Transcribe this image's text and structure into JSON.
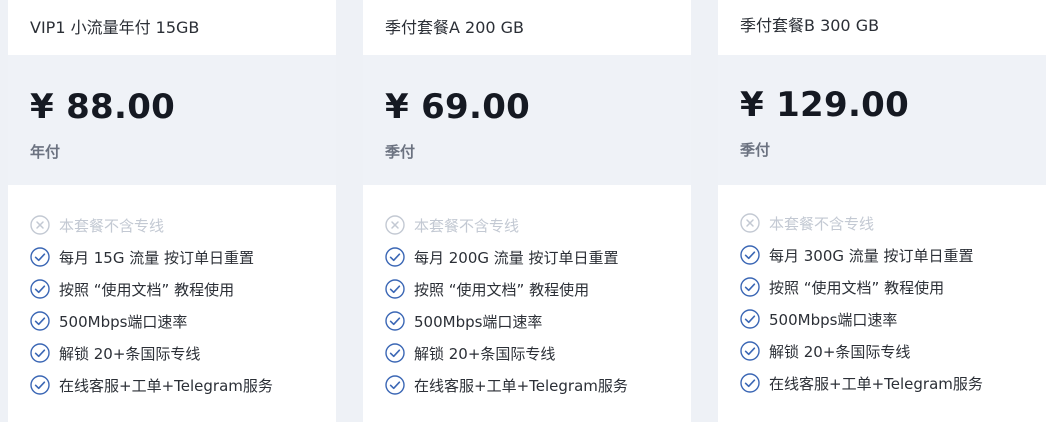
{
  "plans": [
    {
      "name": "VIP1 小流量年付 15GB",
      "price": "¥ 88.00",
      "period": "年付",
      "features": [
        {
          "text": "本套餐不含专线",
          "icon": "x-circle-icon",
          "enabled": false
        },
        {
          "text": "每月 15G 流量 按订单日重置",
          "icon": "check-circle-icon",
          "enabled": true
        },
        {
          "text": "按照 “使用文档” 教程使用",
          "icon": "check-circle-icon",
          "enabled": true
        },
        {
          "text": "500Mbps端口速率",
          "icon": "check-circle-icon",
          "enabled": true
        },
        {
          "text": "解锁 20+条国际专线",
          "icon": "check-circle-icon",
          "enabled": true
        },
        {
          "text": "在线客服+工单+Telegram服务",
          "icon": "check-circle-icon",
          "enabled": true
        }
      ]
    },
    {
      "name": "季付套餐A 200 GB",
      "price": "¥ 69.00",
      "period": "季付",
      "features": [
        {
          "text": "本套餐不含专线",
          "icon": "x-circle-icon",
          "enabled": false
        },
        {
          "text": "每月 200G 流量 按订单日重置",
          "icon": "check-circle-icon",
          "enabled": true
        },
        {
          "text": "按照 “使用文档” 教程使用",
          "icon": "check-circle-icon",
          "enabled": true
        },
        {
          "text": "500Mbps端口速率",
          "icon": "check-circle-icon",
          "enabled": true
        },
        {
          "text": "解锁 20+条国际专线",
          "icon": "check-circle-icon",
          "enabled": true
        },
        {
          "text": "在线客服+工单+Telegram服务",
          "icon": "check-circle-icon",
          "enabled": true
        }
      ]
    },
    {
      "name": "季付套餐B 300 GB",
      "price": "¥ 129.00",
      "period": "季付",
      "features": [
        {
          "text": "本套餐不含专线",
          "icon": "x-circle-icon",
          "enabled": false
        },
        {
          "text": "每月 300G 流量 按订单日重置",
          "icon": "check-circle-icon",
          "enabled": true
        },
        {
          "text": "按照 “使用文档” 教程使用",
          "icon": "check-circle-icon",
          "enabled": true
        },
        {
          "text": "500Mbps端口速率",
          "icon": "check-circle-icon",
          "enabled": true
        },
        {
          "text": "解锁 20+条国际专线",
          "icon": "check-circle-icon",
          "enabled": true
        },
        {
          "text": "在线客服+工单+Telegram服务",
          "icon": "check-circle-icon",
          "enabled": true
        }
      ]
    }
  ],
  "colors": {
    "check": "#3b67b5",
    "x_disabled": "#c3c9d3"
  }
}
